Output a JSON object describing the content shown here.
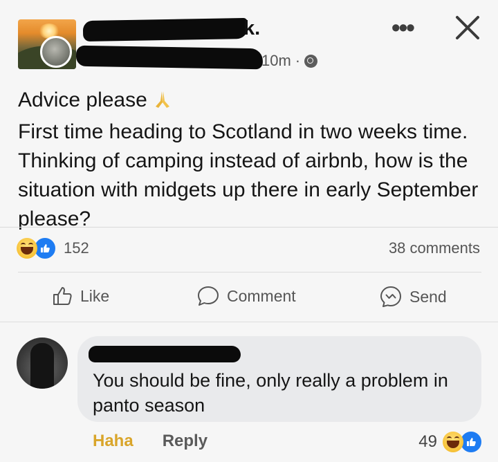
{
  "post": {
    "author_visible_suffix": "k.",
    "timestamp": "10m",
    "timestamp_separator": "·",
    "more_options_label": "•••",
    "paragraph_1": "Advice please",
    "paragraph_2": "First time heading to Scotland in two weeks time. Thinking of camping instead of airbnb, how is the situation with midgets up there in early September please?",
    "reaction_count": "152",
    "comments_count": "38 comments"
  },
  "actions": {
    "like_label": "Like",
    "comment_label": "Comment",
    "send_label": "Send"
  },
  "comment": {
    "text": "You should be fine, only really a problem in panto season",
    "haha_label": "Haha",
    "reply_label": "Reply",
    "reaction_count": "49"
  },
  "colors": {
    "like_blue": "#1e7cf2",
    "haha_yellow": "#f7c238",
    "haha_label": "#d9a52a",
    "bubble_bg": "#e9eaec"
  },
  "icons": [
    "globe-icon",
    "more-options-icon",
    "close-icon",
    "pray-icon",
    "haha-reaction-icon",
    "like-reaction-icon",
    "thumbs-up-icon",
    "comment-icon",
    "messenger-icon"
  ]
}
